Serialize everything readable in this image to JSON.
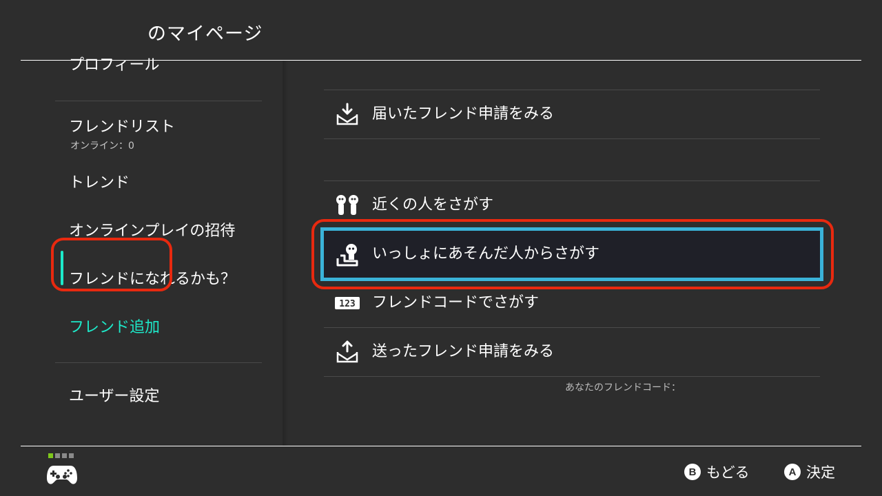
{
  "header": {
    "title": "のマイページ"
  },
  "sidebar": {
    "items": [
      {
        "label": "プロフィール"
      },
      {
        "label": "フレンドリスト",
        "sub": "オンライン：0"
      },
      {
        "label": "トレンド"
      },
      {
        "label": "オンラインプレイの招待"
      },
      {
        "label": "フレンドになれるかも？"
      },
      {
        "label": "フレンド追加",
        "selected": true
      },
      {
        "label": "ユーザー設定"
      }
    ]
  },
  "main": {
    "items": [
      {
        "label": "届いたフレンド申請をみる",
        "icon": "inbox-download-icon"
      },
      {
        "label": "近くの人をさがす",
        "icon": "nearby-people-icon"
      },
      {
        "label": "いっしょにあそんだ人からさがす",
        "icon": "played-with-icon",
        "selected": true
      },
      {
        "label": "フレンドコードでさがす",
        "icon": "friend-code-123-icon"
      },
      {
        "label": "送ったフレンド申請をみる",
        "icon": "outbox-upload-icon"
      }
    ],
    "friend_code_label": "あなたのフレンドコード："
  },
  "footer": {
    "back_key": "B",
    "back_label": "もどる",
    "confirm_key": "A",
    "confirm_label": "決定",
    "active_controller_color": "#7ec81c"
  },
  "colors": {
    "background": "#2d2d2d",
    "accent_teal": "#1de9c9",
    "selection_blue": "#3ab3d9",
    "highlight_red": "#e8290f"
  }
}
